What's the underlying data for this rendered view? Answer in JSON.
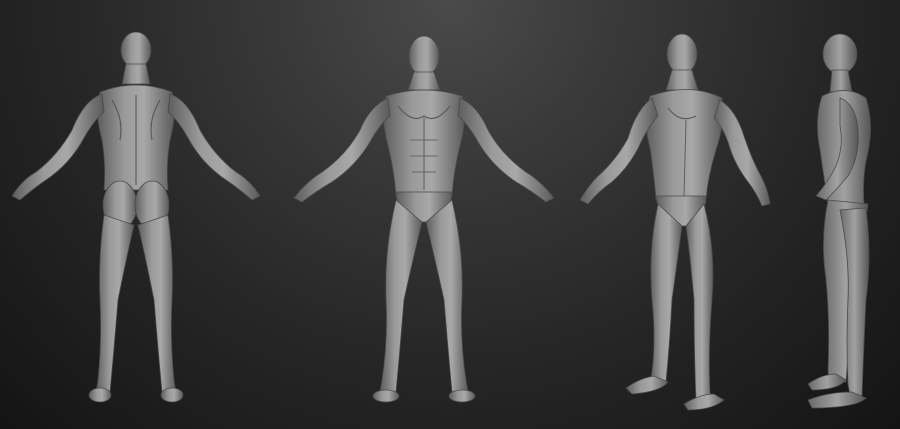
{
  "scene": {
    "background_top": "#464646",
    "background_bottom": "#151515",
    "sculpt_color": "#8f8f8f",
    "views": [
      {
        "id": "back",
        "label": ""
      },
      {
        "id": "front",
        "label": ""
      },
      {
        "id": "three-quarter",
        "label": ""
      },
      {
        "id": "side",
        "label": ""
      }
    ]
  }
}
